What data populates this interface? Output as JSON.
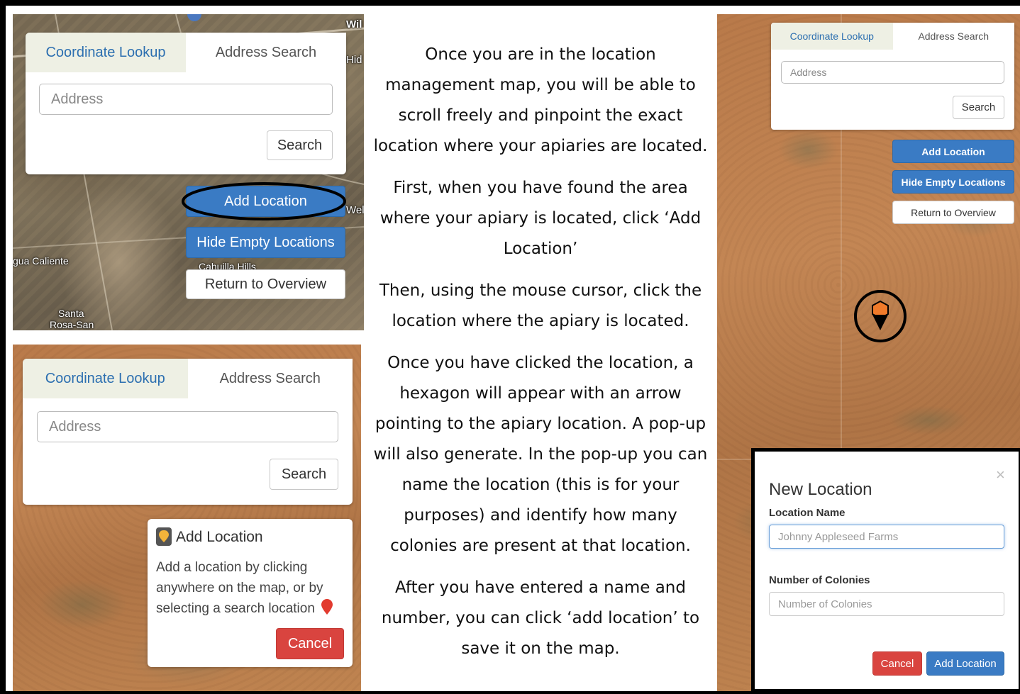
{
  "panel_city": {
    "widget": {
      "tab_coordinate": "Coordinate Lookup",
      "tab_address": "Address Search",
      "address_placeholder": "Address",
      "search_label": "Search"
    },
    "buttons": {
      "add_location": "Add Location",
      "hide_empty": "Hide Empty Locations",
      "return_overview": "Return to Overview"
    },
    "map_labels": {
      "agua_caliente": "gua Caliente",
      "cahuilla_hills": "Cahuilla Hills",
      "santa": "Santa",
      "rosa_san": "Rosa-San",
      "wil": "Wil",
      "hid": "Hid",
      "wel": "Wel"
    }
  },
  "panel_add": {
    "widget": {
      "tab_coordinate": "Coordinate Lookup",
      "tab_address": "Address Search",
      "address_placeholder": "Address",
      "search_label": "Search"
    },
    "popup": {
      "title": "Add Location",
      "body": "Add a location by clicking anywhere on the map, or by selecting a search location",
      "cancel_label": "Cancel"
    }
  },
  "panel_desert": {
    "widget": {
      "tab_coordinate": "Coordinate Lookup",
      "tab_address": "Address Search",
      "address_placeholder": "Address",
      "search_label": "Search"
    },
    "buttons": {
      "add_location": "Add Location",
      "hide_empty": "Hide Empty Locations",
      "return_overview": "Return to Overview"
    },
    "modal": {
      "title": "New Location",
      "close_glyph": "×",
      "name_label": "Location Name",
      "name_value": "Johnny Appleseed Farms",
      "colonies_label": "Number of Colonies",
      "colonies_placeholder": "Number of Colonies",
      "cancel_label": "Cancel",
      "add_label": "Add Location"
    }
  },
  "instructions": [
    "Once you are in the location management map, you will be able to scroll freely and pinpoint the exact location where your apiaries are located.",
    "First, when you have found the area where your apiary is located, click ‘Add Location’",
    "Then, using the mouse cursor, click the location where the apiary is located.",
    "Once you have clicked the location, a hexagon will appear with an arrow pointing to the apiary location. A pop-up will also generate. In the pop-up you can name the location (this is for your purposes) and identify how many colonies are present at that location.",
    "After you have entered a name and number, you can click ‘add location’ to save it on the map."
  ],
  "colors": {
    "primary_blue": "#3a7bc4",
    "danger_red": "#d9443f",
    "tab_active_bg": "#eef0e4",
    "marker_orange": "#f07a2a"
  },
  "icons": {
    "location_pin": "pin-icon",
    "marker": "hexagon-marker-icon"
  }
}
